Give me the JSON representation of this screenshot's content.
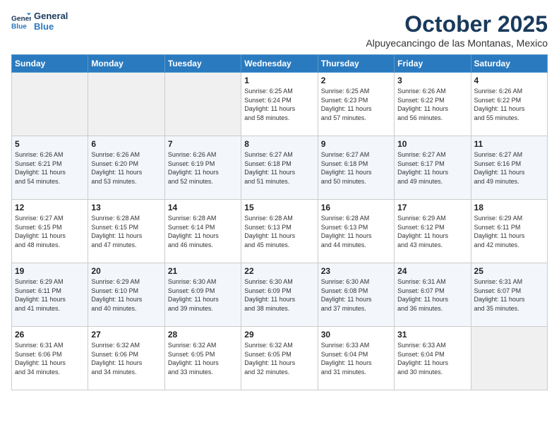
{
  "header": {
    "logo_line1": "General",
    "logo_line2": "Blue",
    "month": "October 2025",
    "location": "Alpuyecancingo de las Montanas, Mexico"
  },
  "days_of_week": [
    "Sunday",
    "Monday",
    "Tuesday",
    "Wednesday",
    "Thursday",
    "Friday",
    "Saturday"
  ],
  "weeks": [
    [
      {
        "day": "",
        "info": ""
      },
      {
        "day": "",
        "info": ""
      },
      {
        "day": "",
        "info": ""
      },
      {
        "day": "1",
        "info": "Sunrise: 6:25 AM\nSunset: 6:24 PM\nDaylight: 11 hours\nand 58 minutes."
      },
      {
        "day": "2",
        "info": "Sunrise: 6:25 AM\nSunset: 6:23 PM\nDaylight: 11 hours\nand 57 minutes."
      },
      {
        "day": "3",
        "info": "Sunrise: 6:26 AM\nSunset: 6:22 PM\nDaylight: 11 hours\nand 56 minutes."
      },
      {
        "day": "4",
        "info": "Sunrise: 6:26 AM\nSunset: 6:22 PM\nDaylight: 11 hours\nand 55 minutes."
      }
    ],
    [
      {
        "day": "5",
        "info": "Sunrise: 6:26 AM\nSunset: 6:21 PM\nDaylight: 11 hours\nand 54 minutes."
      },
      {
        "day": "6",
        "info": "Sunrise: 6:26 AM\nSunset: 6:20 PM\nDaylight: 11 hours\nand 53 minutes."
      },
      {
        "day": "7",
        "info": "Sunrise: 6:26 AM\nSunset: 6:19 PM\nDaylight: 11 hours\nand 52 minutes."
      },
      {
        "day": "8",
        "info": "Sunrise: 6:27 AM\nSunset: 6:18 PM\nDaylight: 11 hours\nand 51 minutes."
      },
      {
        "day": "9",
        "info": "Sunrise: 6:27 AM\nSunset: 6:18 PM\nDaylight: 11 hours\nand 50 minutes."
      },
      {
        "day": "10",
        "info": "Sunrise: 6:27 AM\nSunset: 6:17 PM\nDaylight: 11 hours\nand 49 minutes."
      },
      {
        "day": "11",
        "info": "Sunrise: 6:27 AM\nSunset: 6:16 PM\nDaylight: 11 hours\nand 49 minutes."
      }
    ],
    [
      {
        "day": "12",
        "info": "Sunrise: 6:27 AM\nSunset: 6:15 PM\nDaylight: 11 hours\nand 48 minutes."
      },
      {
        "day": "13",
        "info": "Sunrise: 6:28 AM\nSunset: 6:15 PM\nDaylight: 11 hours\nand 47 minutes."
      },
      {
        "day": "14",
        "info": "Sunrise: 6:28 AM\nSunset: 6:14 PM\nDaylight: 11 hours\nand 46 minutes."
      },
      {
        "day": "15",
        "info": "Sunrise: 6:28 AM\nSunset: 6:13 PM\nDaylight: 11 hours\nand 45 minutes."
      },
      {
        "day": "16",
        "info": "Sunrise: 6:28 AM\nSunset: 6:13 PM\nDaylight: 11 hours\nand 44 minutes."
      },
      {
        "day": "17",
        "info": "Sunrise: 6:29 AM\nSunset: 6:12 PM\nDaylight: 11 hours\nand 43 minutes."
      },
      {
        "day": "18",
        "info": "Sunrise: 6:29 AM\nSunset: 6:11 PM\nDaylight: 11 hours\nand 42 minutes."
      }
    ],
    [
      {
        "day": "19",
        "info": "Sunrise: 6:29 AM\nSunset: 6:11 PM\nDaylight: 11 hours\nand 41 minutes."
      },
      {
        "day": "20",
        "info": "Sunrise: 6:29 AM\nSunset: 6:10 PM\nDaylight: 11 hours\nand 40 minutes."
      },
      {
        "day": "21",
        "info": "Sunrise: 6:30 AM\nSunset: 6:09 PM\nDaylight: 11 hours\nand 39 minutes."
      },
      {
        "day": "22",
        "info": "Sunrise: 6:30 AM\nSunset: 6:09 PM\nDaylight: 11 hours\nand 38 minutes."
      },
      {
        "day": "23",
        "info": "Sunrise: 6:30 AM\nSunset: 6:08 PM\nDaylight: 11 hours\nand 37 minutes."
      },
      {
        "day": "24",
        "info": "Sunrise: 6:31 AM\nSunset: 6:07 PM\nDaylight: 11 hours\nand 36 minutes."
      },
      {
        "day": "25",
        "info": "Sunrise: 6:31 AM\nSunset: 6:07 PM\nDaylight: 11 hours\nand 35 minutes."
      }
    ],
    [
      {
        "day": "26",
        "info": "Sunrise: 6:31 AM\nSunset: 6:06 PM\nDaylight: 11 hours\nand 34 minutes."
      },
      {
        "day": "27",
        "info": "Sunrise: 6:32 AM\nSunset: 6:06 PM\nDaylight: 11 hours\nand 34 minutes."
      },
      {
        "day": "28",
        "info": "Sunrise: 6:32 AM\nSunset: 6:05 PM\nDaylight: 11 hours\nand 33 minutes."
      },
      {
        "day": "29",
        "info": "Sunrise: 6:32 AM\nSunset: 6:05 PM\nDaylight: 11 hours\nand 32 minutes."
      },
      {
        "day": "30",
        "info": "Sunrise: 6:33 AM\nSunset: 6:04 PM\nDaylight: 11 hours\nand 31 minutes."
      },
      {
        "day": "31",
        "info": "Sunrise: 6:33 AM\nSunset: 6:04 PM\nDaylight: 11 hours\nand 30 minutes."
      },
      {
        "day": "",
        "info": ""
      }
    ]
  ]
}
